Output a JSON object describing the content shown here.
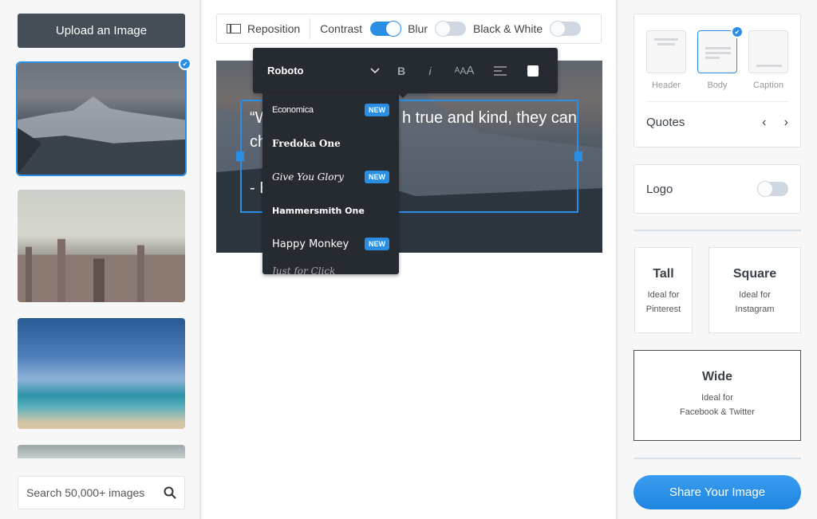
{
  "left_panel": {
    "upload_label": "Upload an Image",
    "thumbnails": [
      {
        "name": "mountain",
        "selected": true
      },
      {
        "name": "city-skyline",
        "selected": false
      },
      {
        "name": "beach",
        "selected": false
      },
      {
        "name": "sky",
        "selected": false
      }
    ],
    "search_placeholder": "Search 50,000+ images",
    "search_icon": "search-icon"
  },
  "toolbar": {
    "reposition_label": "Reposition",
    "contrast_label": "Contrast",
    "contrast_on": true,
    "blur_label": "Blur",
    "blur_on": false,
    "bw_label": "Black & White",
    "bw_on": false
  },
  "format_bar": {
    "font_name": "Roboto",
    "bold_label": "B",
    "italic_label": "i",
    "size_label": "AAA",
    "align_icon": "align-left-icon",
    "text_color": "#ffffff"
  },
  "font_list": [
    {
      "name": "Economica",
      "is_new": true,
      "badge": "NEW"
    },
    {
      "name": "Fredoka One",
      "is_new": false,
      "badge": ""
    },
    {
      "name": "Give You Glory",
      "is_new": true,
      "badge": "NEW"
    },
    {
      "name": "Hammersmith One",
      "is_new": false,
      "badge": ""
    },
    {
      "name": "Happy Monkey",
      "is_new": true,
      "badge": "NEW"
    },
    {
      "name": "Just for Click",
      "is_new": false,
      "badge": ""
    }
  ],
  "canvas": {
    "quote_line1_left": "“W",
    "quote_line1_right": "h true and kind, they can",
    "quote_line2_left": "ch",
    "quote_line3_left": "- E"
  },
  "right_panel": {
    "layouts": [
      {
        "label": "Header",
        "selected": false
      },
      {
        "label": "Body",
        "selected": true
      },
      {
        "label": "Caption",
        "selected": false
      }
    ],
    "quotes_label": "Quotes",
    "prev_icon": "‹",
    "next_icon": "›",
    "logo_label": "Logo",
    "logo_on": false,
    "sizes": [
      {
        "title": "Tall",
        "line1": "Ideal for",
        "line2": "Pinterest",
        "selected": false
      },
      {
        "title": "Square",
        "line1": "Ideal for",
        "line2": "Instagram",
        "selected": false
      },
      {
        "title": "Wide",
        "line1": "Ideal for",
        "line2": "Facebook & Twitter",
        "selected": true
      }
    ],
    "share_label": "Share Your Image"
  },
  "colors": {
    "accent": "#2a8ee5",
    "dark": "#262a31",
    "upload_button": "#454d56"
  }
}
